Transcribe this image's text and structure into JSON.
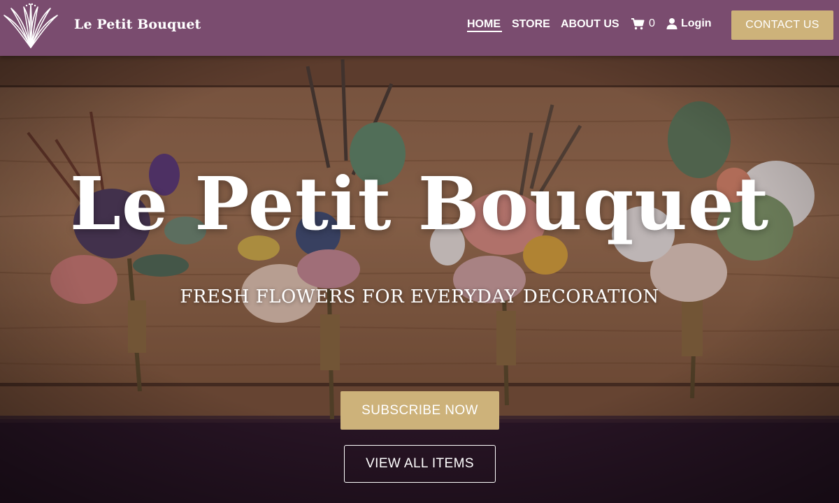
{
  "header": {
    "brand_name": "Le Petit Bouquet",
    "logo_icon": "lotus-flower-icon",
    "nav": {
      "home": "HOME",
      "store": "STORE",
      "about": "ABOUT US"
    },
    "cart_icon": "shopping-cart-icon",
    "cart_count": "0",
    "login_icon": "user-icon",
    "login_label": "Login",
    "contact_button": "CONTACT US"
  },
  "hero": {
    "title": "Le Petit Bouquet",
    "subtitle": "FRESH FLOWERS FOR EVERYDAY DECORATION",
    "subscribe_button": "SUBSCRIBE NOW",
    "view_button": "VIEW ALL ITEMS"
  },
  "colors": {
    "header_bg": "#7a4c6f",
    "accent_gold": "#cdb27a",
    "text_white": "#ffffff",
    "dark_bottom": "#2a1727"
  }
}
